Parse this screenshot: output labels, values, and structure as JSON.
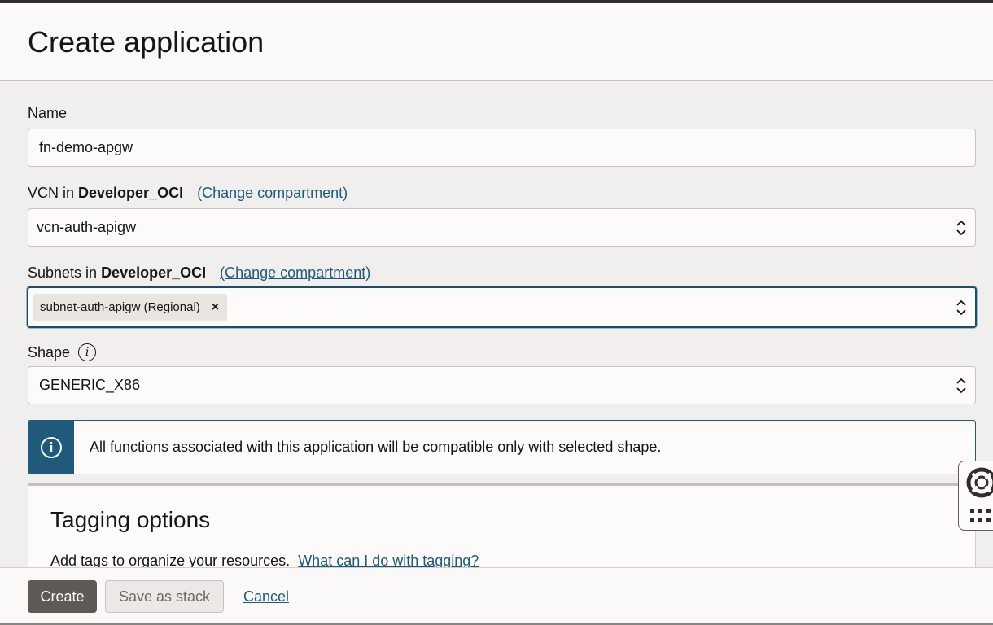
{
  "header": {
    "title": "Create application"
  },
  "form": {
    "name": {
      "label": "Name",
      "value": "fn-demo-apgw"
    },
    "vcn": {
      "label_prefix": "VCN in",
      "compartment": "Developer_OCI",
      "change_link": "(Change compartment)",
      "value": "vcn-auth-apigw"
    },
    "subnets": {
      "label_prefix": "Subnets in",
      "compartment": "Developer_OCI",
      "change_link": "(Change compartment)",
      "chip": "subnet-auth-apigw (Regional)",
      "chip_remove": "×"
    },
    "shape": {
      "label": "Shape",
      "info_glyph": "i",
      "value": "GENERIC_X86"
    }
  },
  "banner": {
    "text": "All functions associated with this application will be compatible only with selected shape."
  },
  "tagging": {
    "title": "Tagging options",
    "desc": "Add tags to organize your resources.",
    "link": "What can I do with tagging?"
  },
  "footer": {
    "create": "Create",
    "save_stack": "Save as stack",
    "cancel": "Cancel"
  },
  "icons": {
    "info": "info-icon",
    "help": "lifebuoy-icon",
    "apps": "grid-icon",
    "chevron": "chevron-up-down-icon"
  },
  "colors": {
    "accent": "#1f5a7a",
    "primary_button": "#5f5a56",
    "focus_border": "#1c4d67"
  }
}
